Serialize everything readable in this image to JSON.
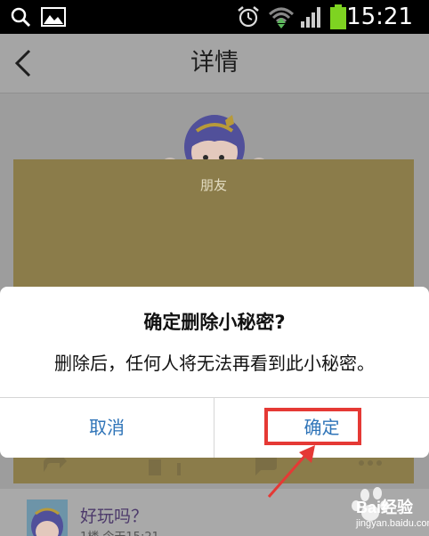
{
  "status_bar": {
    "time": "15:21",
    "icons": [
      "search-icon",
      "image-icon",
      "alarm-icon",
      "wifi-icon",
      "signal-icon",
      "battery-icon"
    ]
  },
  "header": {
    "back_icon": "chevron-left-icon",
    "title": "详情"
  },
  "card": {
    "tag": "朋友",
    "background_color": "#8b7c4a"
  },
  "dialog": {
    "title": "确定删除小秘密?",
    "message": "删除后，任何人将无法再看到此小秘密。",
    "cancel_label": "取消",
    "confirm_label": "确定"
  },
  "comment": {
    "text": "好玩吗？",
    "meta": "1楼 今天15:21"
  },
  "colors": {
    "dialog_button": "#2f74b8",
    "highlight": "#e53935",
    "overlay": "#9d9d9d"
  },
  "watermark": {
    "brand": "Bai经验",
    "url": "jingyan.baidu.com"
  }
}
